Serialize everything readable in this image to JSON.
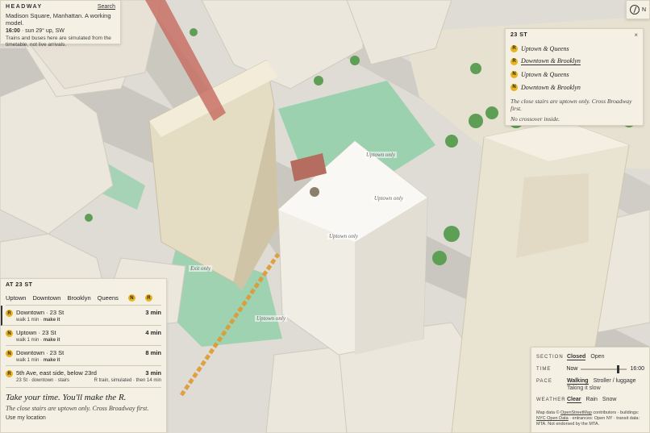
{
  "header": {
    "brand": "HEADWAY",
    "search_label": "Search",
    "subtitle": "Madison Square, Manhattan. A working model.",
    "time_value": "16:00",
    "time_rest": " · sun 29° up, SW",
    "note": "Trains and buses here are simulated from the timetable, not live arrivals."
  },
  "compass": {
    "label": "N",
    "icon": "compass-icon"
  },
  "station": {
    "title": "23 ST",
    "close": "×",
    "routes": [
      {
        "line": "R",
        "label": "Uptown & Queens",
        "selected": false
      },
      {
        "line": "R",
        "label": "Downtown & Brooklyn",
        "selected": true
      },
      {
        "line": "N",
        "label": "Uptown & Queens",
        "selected": false
      },
      {
        "line": "N",
        "label": "Downtown & Brooklyn",
        "selected": false
      }
    ],
    "note1": "The close stairs are uptown only. Cross Broadway first.",
    "note2": "No crossover inside."
  },
  "departures": {
    "title": "AT 23 ST",
    "tabs": [
      "Uptown",
      "Downtown",
      "Brooklyn",
      "Queens"
    ],
    "tab_bullets": [
      "N",
      "R"
    ],
    "rows": [
      {
        "line": "R",
        "name": "Downtown · 23 St",
        "walk": "walk 1 min · ",
        "action": "make it",
        "mins": "3 min",
        "active": true
      },
      {
        "line": "N",
        "name": "Uptown · 23 St",
        "walk": "walk 1 min · ",
        "action": "make it",
        "mins": "4 min",
        "active": false
      },
      {
        "line": "N",
        "name": "Downtown · 23 St",
        "walk": "walk 1 min · ",
        "action": "make it",
        "mins": "8 min",
        "active": false
      }
    ],
    "bus": {
      "line": "R",
      "name": "5th Ave, east side, below 23rd",
      "detail": "23 St · downtown · stairs",
      "mins": "3 min",
      "extra": "R train, simulated · then 14 min"
    },
    "headline": "Take your time. You'll make the R.",
    "tip": "The close stairs are uptown only. Cross Broadway first.",
    "location": "Use my location"
  },
  "controls": {
    "section_label": "SECTION",
    "section_options": [
      "Closed",
      "Open"
    ],
    "time_label": "TIME",
    "time_now": "Now",
    "time_value": "16:00",
    "slider_fraction": 0.8,
    "pace_label": "PACE",
    "pace_options": [
      "Walking",
      "Stroller / luggage"
    ],
    "pace_note": "Taking it slow",
    "weather_label": "WEATHER",
    "weather_options": [
      "Clear",
      "Rain",
      "Snow"
    ],
    "attribution": [
      "Map data © ",
      "OpenStreetMap",
      " contributors · buildings: ",
      "NYC Open Data",
      " · entrances: Open NY · transit data: MTA. Not endorsed by the MTA."
    ]
  },
  "map_labels": [
    "Uptown only",
    "Uptown only",
    "Uptown only",
    "Exit only",
    "Uptown only"
  ],
  "colors": {
    "bullet": "#e8b31e",
    "plaza": "#7fc7a0",
    "park": "#5f9e55",
    "panel": "#f4f0e4"
  }
}
